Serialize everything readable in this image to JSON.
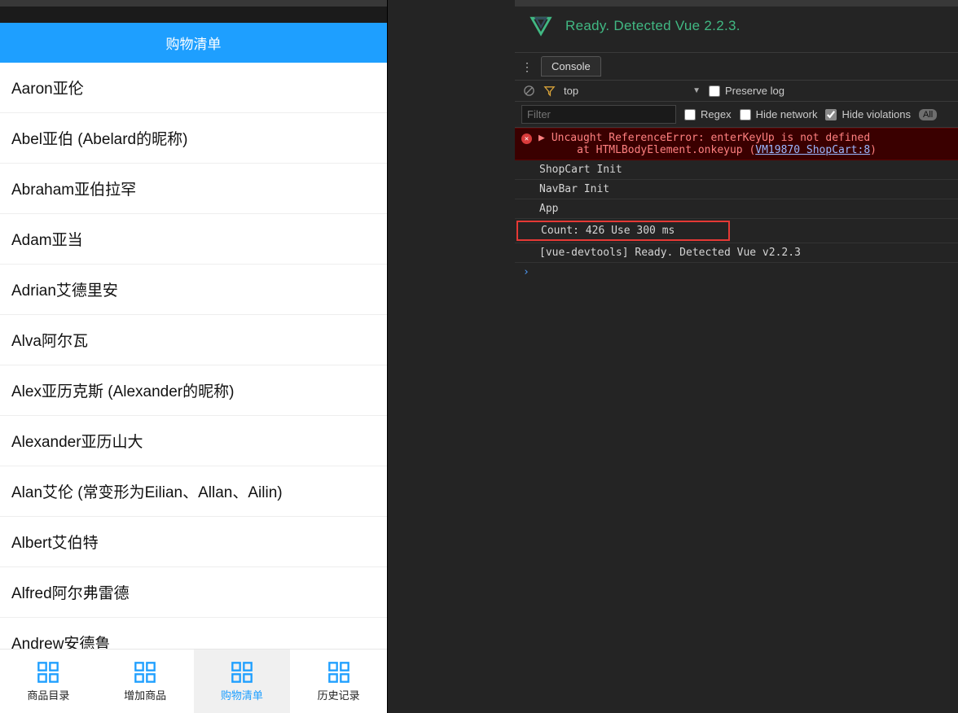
{
  "left": {
    "header_title": "购物清单",
    "list_items": [
      "Aaron亚伦",
      "Abel亚伯 (Abelard的昵称)",
      "Abraham亚伯拉罕",
      "Adam亚当",
      "Adrian艾德里安",
      "Alva阿尔瓦",
      "Alex亚历克斯 (Alexander的昵称)",
      "Alexander亚历山大",
      "Alan艾伦 (常变形为Eilian、Allan、Ailin)",
      "Albert艾伯特",
      "Alfred阿尔弗雷德",
      "Andrew安德鲁"
    ],
    "tabs": [
      {
        "label": "商品目录",
        "active": false
      },
      {
        "label": "增加商品",
        "active": false
      },
      {
        "label": "购物清单",
        "active": true
      },
      {
        "label": "历史记录",
        "active": false
      }
    ]
  },
  "devtools": {
    "vue_ready_text": "Ready. Detected Vue 2.2.3.",
    "console_tab_label": "Console",
    "context_label": "top",
    "preserve_log_label": "Preserve log",
    "filter_placeholder": "Filter",
    "regex_label": "Regex",
    "hide_network_label": "Hide network",
    "hide_violations_label": "Hide violations",
    "hide_violations_checked": true,
    "level_all_label": "All",
    "error": {
      "line1": "Uncaught ReferenceError: enterKeyUp is not defined",
      "line2_pre": "    at HTMLBodyElement.onkeyup (",
      "line2_link": "VM19870 ShopCart:8",
      "line2_post": ")"
    },
    "logs": [
      "ShopCart Init",
      "NavBar Init",
      "App"
    ],
    "highlight_log": "Count: 426 Use 300 ms",
    "logs_after": [
      "[vue-devtools] Ready. Detected Vue v2.2.3"
    ],
    "prompt_symbol": "›"
  }
}
